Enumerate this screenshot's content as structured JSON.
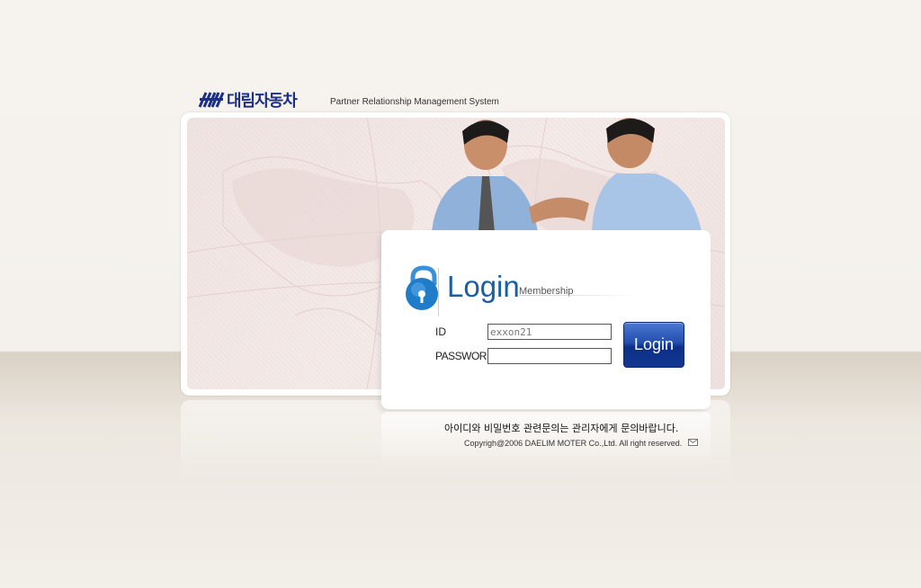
{
  "brand": {
    "logo_text": "대림자동차",
    "tagline": "Partner Relationship Management System"
  },
  "login": {
    "title": "Login",
    "subtitle": "Membership",
    "id_label": "ID",
    "password_label": "PASSWORD",
    "id_value": "exxon21",
    "password_value": "",
    "button_label": "Login"
  },
  "footer": {
    "notice": "아이디와 비밀번호 관련문의는 관리자에게 문의바랍니다.",
    "copyright": "Copyrigh@2006 DAELIM MOTER Co.,Ltd. All right reserved."
  },
  "colors": {
    "brand": "#1b2f86",
    "accent": "#1a5fa3",
    "button": "#13368f"
  },
  "icons": [
    "lock-icon",
    "mail-icon",
    "brand-logo-mark"
  ]
}
